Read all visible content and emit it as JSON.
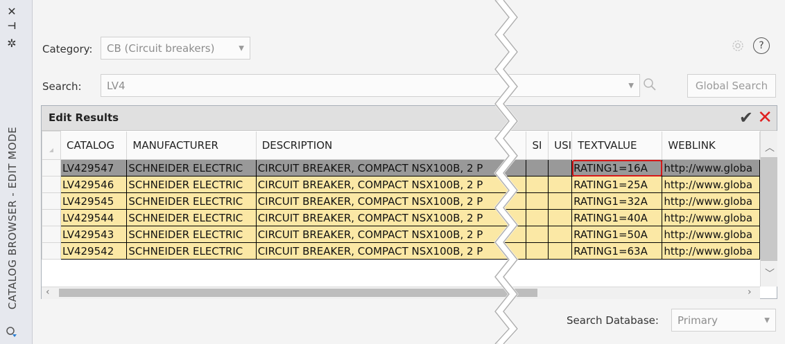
{
  "sidebar": {
    "close_glyph": "✕",
    "pin_glyph": "⊣",
    "settings_glyph": "✲",
    "title": "CATALOG BROWSER - EDIT MODE",
    "icons": [
      "close-icon",
      "pin-icon",
      "settings-icon",
      "refresh-icon"
    ]
  },
  "header": {
    "category_label": "Category:",
    "category_value": "CB (Circuit breakers)",
    "search_label": "Search:",
    "search_value": "LV4",
    "global_search_label": "Global Search",
    "help_glyph": "?"
  },
  "results": {
    "title": "Edit Results",
    "accept_glyph": "✔",
    "cancel_glyph": "✕",
    "columns": [
      "CATALOG",
      "MANUFACTURER",
      "DESCRIPTION",
      "SI",
      "USI",
      "TEXTVALUE",
      "WEBLINK"
    ],
    "rows": [
      {
        "catalog": "LV429547",
        "manufacturer": "SCHNEIDER ELECTRIC",
        "description": "CIRCUIT BREAKER, COMPACT NSX100B, 2 P",
        "textvalue": "RATING1=16A",
        "weblink": "http://www.globa"
      },
      {
        "catalog": "LV429546",
        "manufacturer": "SCHNEIDER ELECTRIC",
        "description": "CIRCUIT BREAKER, COMPACT NSX100B, 2 P",
        "textvalue": "RATING1=25A",
        "weblink": "http://www.globa"
      },
      {
        "catalog": "LV429545",
        "manufacturer": "SCHNEIDER ELECTRIC",
        "description": "CIRCUIT BREAKER, COMPACT NSX100B, 2 P",
        "textvalue": "RATING1=32A",
        "weblink": "http://www.globa"
      },
      {
        "catalog": "LV429544",
        "manufacturer": "SCHNEIDER ELECTRIC",
        "description": "CIRCUIT BREAKER, COMPACT NSX100B, 2 P",
        "textvalue": "RATING1=40A",
        "weblink": "http://www.globa"
      },
      {
        "catalog": "LV429543",
        "manufacturer": "SCHNEIDER ELECTRIC",
        "description": "CIRCUIT BREAKER, COMPACT NSX100B, 2 P",
        "textvalue": "RATING1=50A",
        "weblink": "http://www.globa"
      },
      {
        "catalog": "LV429542",
        "manufacturer": "SCHNEIDER ELECTRIC",
        "description": "CIRCUIT BREAKER, COMPACT NSX100B, 2 P",
        "textvalue": "RATING1=63A",
        "weblink": "http://www.globa"
      }
    ]
  },
  "footer": {
    "db_label": "Search Database:",
    "db_value": "Primary"
  },
  "colors": {
    "row_fill": "#fbe8a5",
    "selected_row_fill": "#999999",
    "highlight_border": "#d61818",
    "cancel_red": "#e02020"
  }
}
